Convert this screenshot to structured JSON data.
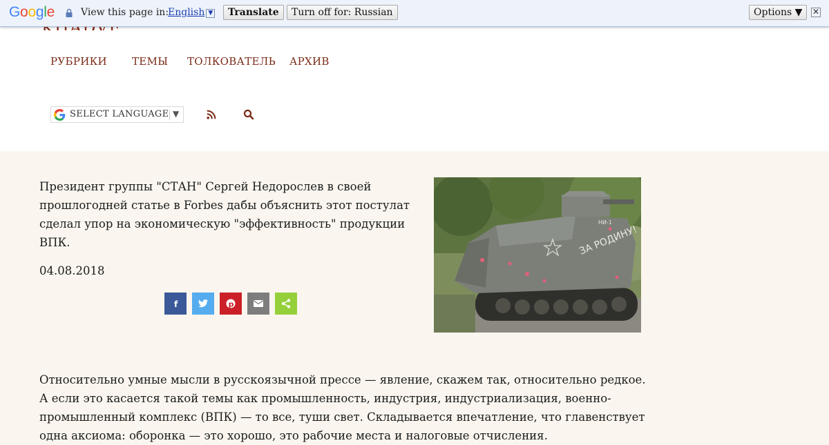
{
  "translate_bar": {
    "logo": "Google",
    "view_text": "View this page in:",
    "language": "English",
    "translate_label": "Translate",
    "turn_off_label": "Turn off for: Russian",
    "options_label": "Options ▼",
    "close_glyph": "✕"
  },
  "site": {
    "logo_text": "KHADVE"
  },
  "nav": {
    "items": [
      {
        "label": "РУБРИКИ"
      },
      {
        "label": "ТЕМЫ"
      },
      {
        "label": "ТОЛКОВАТЕЛЬ"
      },
      {
        "label": "АРХИВ"
      }
    ]
  },
  "language_select": {
    "label": "SELECT LANGUAGE",
    "arrow": "▼"
  },
  "icons": {
    "rss": "rss-icon",
    "search": "search-icon"
  },
  "article": {
    "lead": "Президент группы \"СТАН\" Сергей Недорослев в своей прошлогодней статье в Forbes дабы объяснить этот постулат сделал упор на экономическую \"эффективность\" продукции ВПК.",
    "date": "04.08.2018",
    "photo_text": "ЗА РОДИНУ!",
    "photo_tag": "НИ-1",
    "body": "Относительно умные мысли в русскоязычной прессе — явление, скажем так, относительно редкое. А если это касается такой темы как промышленность, индустрия, индустриализация, военно-промышленный комплекс (ВПК) — то все, туши свет. Складывается впечатление, что главенствует одна аксиома: оборонка — это хорошо, это рабочие места и налоговые отчисления."
  },
  "share": [
    {
      "name": "facebook",
      "color": "#3b5998"
    },
    {
      "name": "twitter",
      "color": "#55acee"
    },
    {
      "name": "pinterest",
      "color": "#cb2027"
    },
    {
      "name": "email",
      "color": "#7d7d7d"
    },
    {
      "name": "sharethis",
      "color": "#95d03a"
    }
  ],
  "colors": {
    "nav_text": "#7a2a16",
    "page_bg": "#faf6ef",
    "bar_bg": "#eef3fb"
  }
}
